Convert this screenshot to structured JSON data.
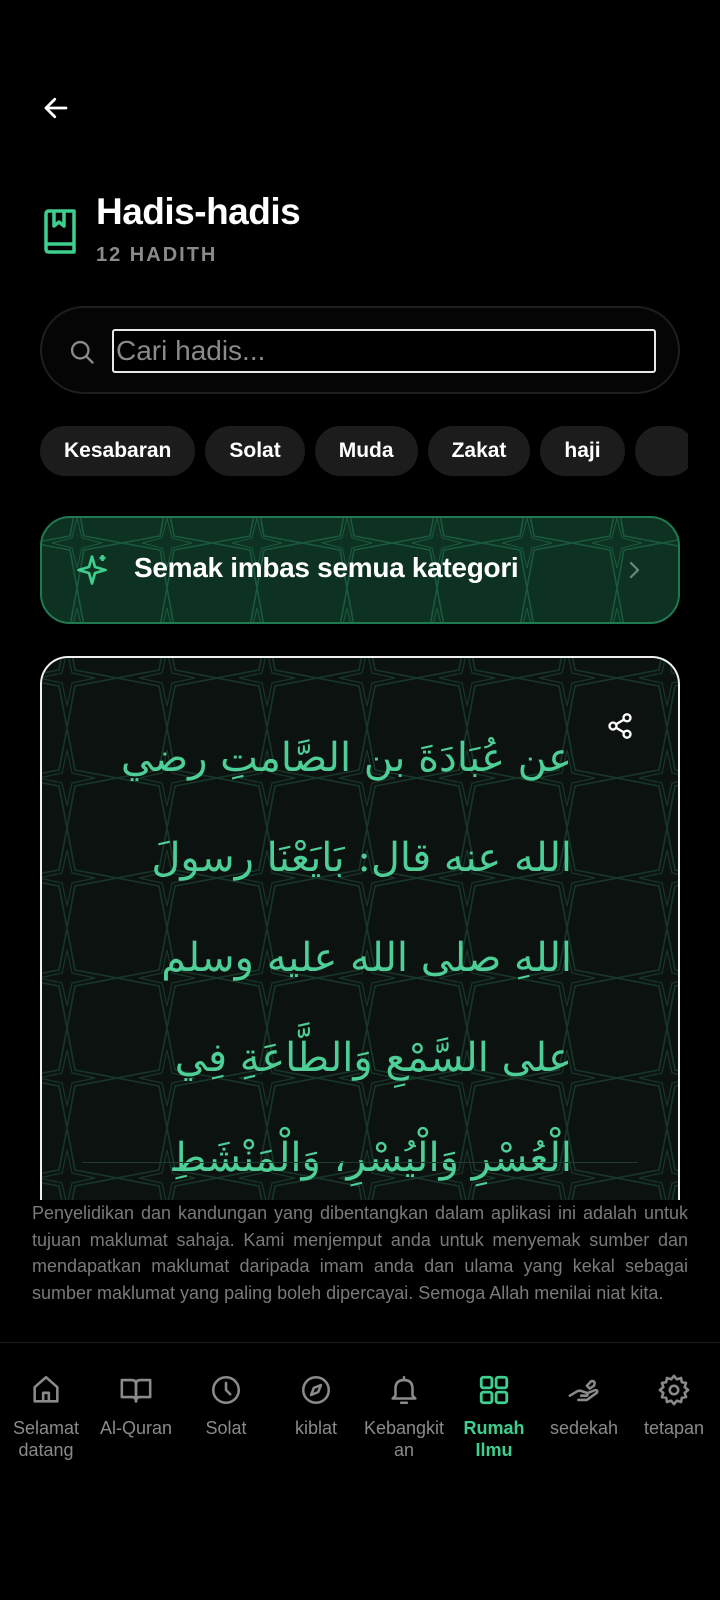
{
  "header": {
    "title": "Hadis-hadis",
    "subtitle": "12 HADITH"
  },
  "search": {
    "placeholder": "Cari hadis...",
    "value": ""
  },
  "categories": [
    "Kesabaran",
    "Solat",
    "Muda",
    "Zakat",
    "haji"
  ],
  "banner": {
    "label": "Semak imbas semua kategori"
  },
  "hadith": {
    "arabic": "عن عُبَادَةَ بن الصَّامتِ رضي الله عنه قال: بَايَعْنَا رسولَ اللهِ صلى الله عليه وسلم على السَّمْعِ وَالطَّاعَةِ فِي الْعُسْرِ وَالْيُسْرِ، وَالْمَنْشَطِ وَالْمَكْرِهِ، وعلى أَثَرَةٍ"
  },
  "disclaimer": "Penyelidikan dan kandungan yang dibentangkan dalam aplikasi ini adalah untuk tujuan maklumat sahaja. Kami menjemput anda untuk menyemak sumber dan mendapatkan maklumat daripada imam anda dan ulama yang kekal sebagai sumber maklumat yang paling boleh dipercayai. Semoga Allah menilai niat kita.",
  "nav": {
    "items": [
      {
        "label": "Selamat datang",
        "icon": "home-icon"
      },
      {
        "label": "Al-Quran",
        "icon": "open-book-icon"
      },
      {
        "label": "Solat",
        "icon": "clock-icon"
      },
      {
        "label": "kiblat",
        "icon": "compass-icon"
      },
      {
        "label": "Kebangkitan",
        "icon": "bell-icon"
      },
      {
        "label": "Rumah Ilmu",
        "icon": "grid-icon",
        "active": true
      },
      {
        "label": "sedekah",
        "icon": "giving-hand-icon"
      },
      {
        "label": "tetapan",
        "icon": "gear-icon"
      }
    ]
  },
  "colors": {
    "accent": "#3ecf8e",
    "arabic_text": "#4ecf97",
    "banner_bg": "#0d3222",
    "banner_border": "#1f7a50",
    "background": "#000000"
  }
}
